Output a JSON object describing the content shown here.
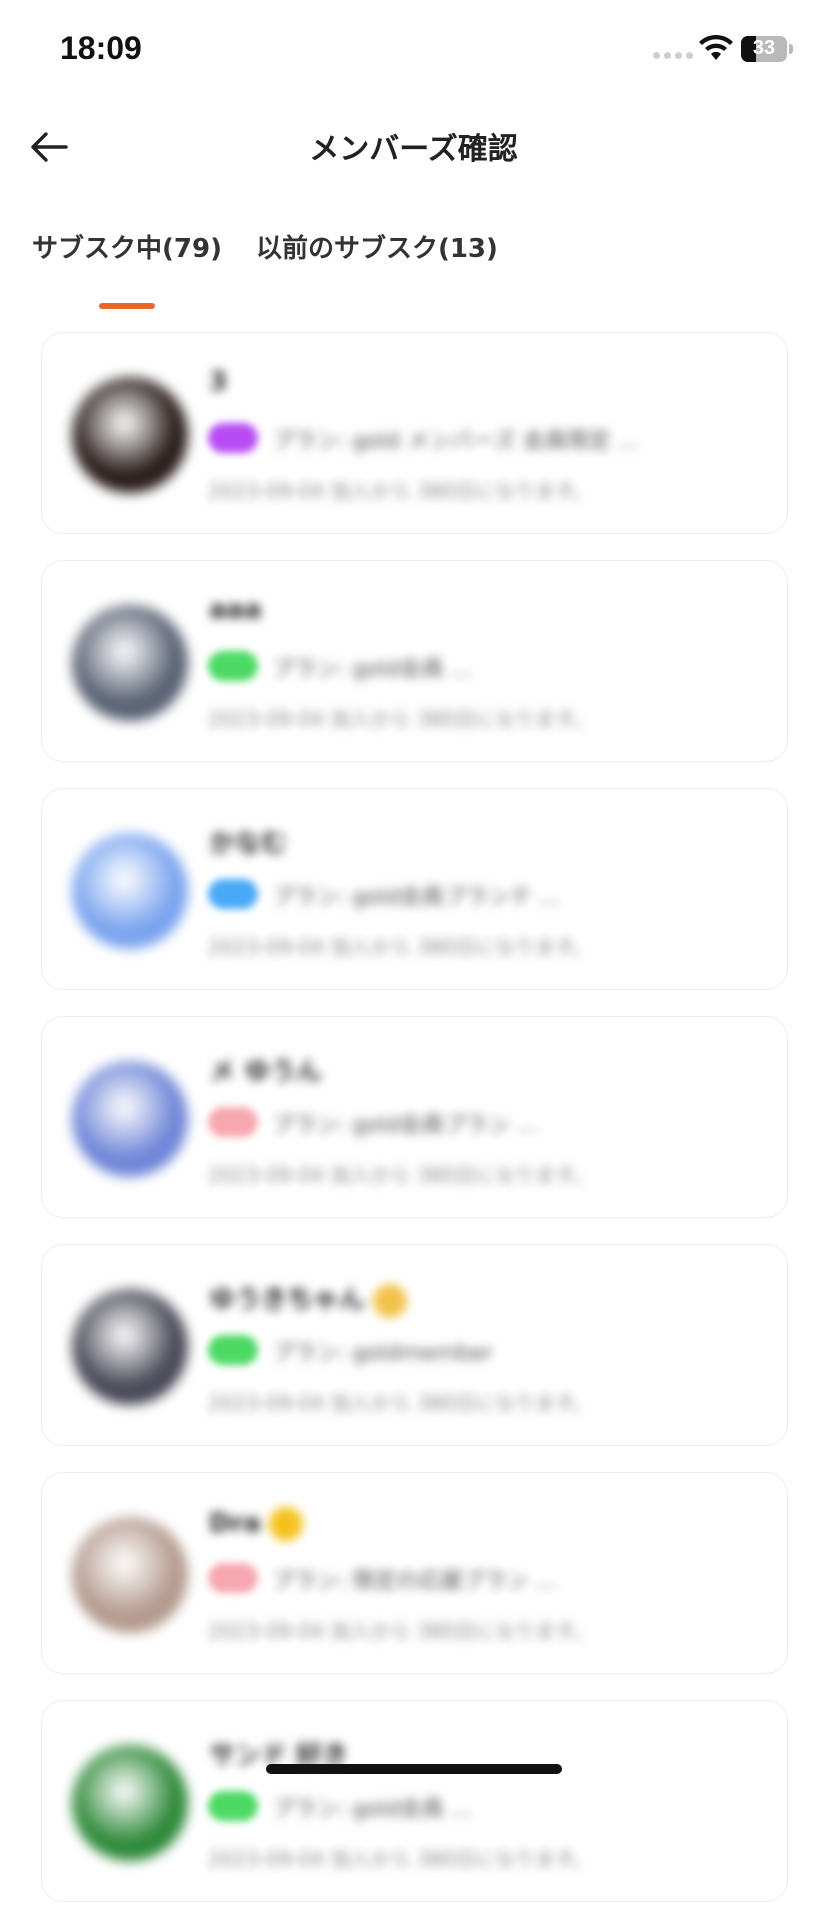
{
  "status_bar": {
    "time": "18:09",
    "battery": "33",
    "battery_level": 0.33,
    "icons": [
      "cellular-signal-icon",
      "wifi-icon",
      "battery-icon"
    ]
  },
  "nav": {
    "back_icon": "arrow-left-icon",
    "title": "メンバーズ確認"
  },
  "tabs": [
    {
      "label": "サブスク中(79)",
      "active": true
    },
    {
      "label": "以前のサブスク(13)",
      "active": false
    }
  ],
  "colors": {
    "accent": "#e8672a",
    "badge_purple": "#b84cf3",
    "badge_green": "#4cd964",
    "badge_blue": "#48a9f8",
    "badge_pink": "#f7a7b0"
  },
  "members": [
    {
      "name": "3",
      "badge_color": "#b84cf3",
      "plan": "プラン: gold メンバーズ 会員限定 ...",
      "meta": "2023-09-04 加入から 380日になります。",
      "avatar_color": "#2b1f1c"
    },
    {
      "name": "aaa",
      "badge_color": "#4cd964",
      "plan": "プラン: gold会員 ...",
      "meta": "2023-09-04 加入から 380日になります。",
      "avatar_color": "#5a6274"
    },
    {
      "name": "かなむ",
      "badge_color": "#48a9f8",
      "plan": "プラン: gold会員プランテ ...",
      "meta": "2023-09-04 加入から 380日になります。",
      "avatar_color": "#7aa4ef"
    },
    {
      "name": "メ ゆうん",
      "badge_color": "#f7a7b0",
      "plan": "プラン: gold会員プラン ...",
      "meta": "2023-09-04 加入から 380日になります。",
      "avatar_color": "#6f86d8"
    },
    {
      "name": "ゆうきちゃん",
      "badge_color": "#4cd964",
      "plan": "プラン: goldmember",
      "meta": "2023-09-04 加入から 380日になります。",
      "avatar_color": "#4a4a58",
      "emoji_color": "#f2c24a"
    },
    {
      "name": "Dra",
      "badge_color": "#f7a7b0",
      "plan": "プラン: 限定の応援プラン ...",
      "meta": "2023-09-04 加入から 380日になります。",
      "avatar_color": "#b49a8e",
      "emoji_color": "#f4c21c"
    },
    {
      "name": "サンド 好き",
      "badge_color": "#4cd964",
      "plan": "プラン: gold会員 ...",
      "meta": "2023-09-04 加入から 380日になります。",
      "avatar_color": "#2f8a3a"
    }
  ]
}
